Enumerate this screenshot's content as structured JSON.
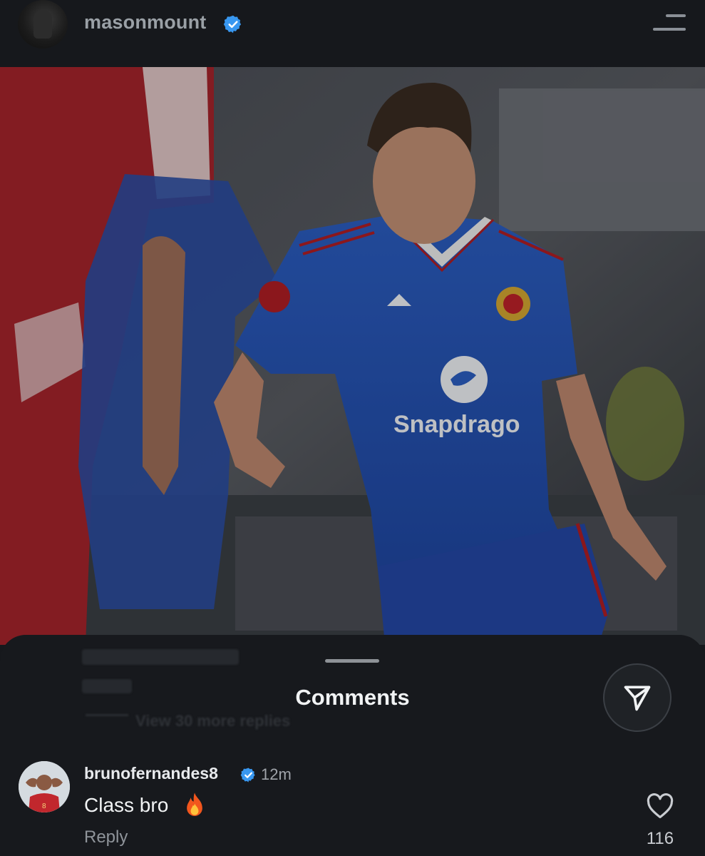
{
  "header": {
    "username": "masonmount",
    "avatar_icon": "profile-avatar",
    "verified_icon": "verified-badge-icon",
    "menu_icon": "hamburger-menu-icon"
  },
  "photo": {
    "description_icon": "post-photo",
    "shirt_sponsor": "Snapdrago"
  },
  "comments_sheet": {
    "title": "Comments",
    "faded_text": "View 30 more replies",
    "send_icon": "send-icon",
    "comment": {
      "username": "brunofernandes8",
      "time": "12m",
      "text": "Class bro",
      "emoji": "🔥",
      "reply_label": "Reply",
      "like_count": "116",
      "like_icon": "heart-outline-icon"
    }
  },
  "colors": {
    "background": "#16181c",
    "verified_blue": "#3897f0",
    "kit_blue": "#2a55b8"
  }
}
